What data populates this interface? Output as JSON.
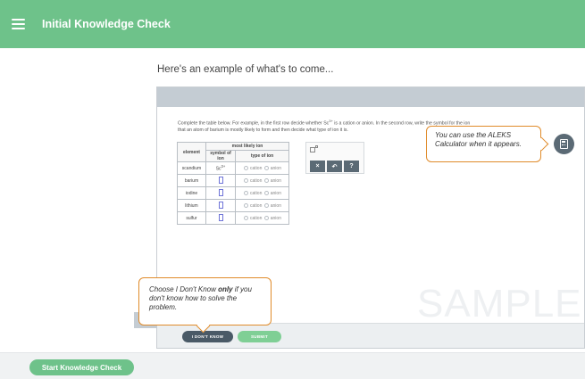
{
  "header": {
    "title": "Initial Knowledge Check"
  },
  "intro": "Here's an example of what's to come...",
  "question": {
    "line1_a": "Complete the table below. For example, in the first row decide whether Sc",
    "line1_sup": "3+",
    "line1_b": " is a cation or anion. In the second row, write the symbol for the ion",
    "line2": "that an atom of barium is mostly likely to form and then decide what type of ion it is."
  },
  "table": {
    "header_element": "element",
    "header_group": "most likely ion",
    "header_symbol": "symbol of ion",
    "header_type": "type of ion",
    "cation_label": "cation",
    "anion_label": "anion",
    "rows": [
      {
        "element": "scandium",
        "symbol": "Sc",
        "sup": "3+"
      },
      {
        "element": "barium"
      },
      {
        "element": "iodine"
      },
      {
        "element": "lithium"
      },
      {
        "element": "sulfur"
      }
    ]
  },
  "tools": {
    "clear": "×",
    "undo": "↶",
    "help": "?"
  },
  "calculator_callout": "You can use the ALEKS Calculator when it appears.",
  "watermark": "SAMPLE",
  "idk_callout": {
    "before": "Choose I Don't Know ",
    "emph": "only",
    "after": " if you don't know how to solve the problem."
  },
  "buttons": {
    "idk": "I DON'T KNOW",
    "submit": "SUBMIT",
    "start": "Start Knowledge Check"
  },
  "colors": {
    "brand": "#6ec28a",
    "callout_border": "#e08b2a",
    "dark": "#4a5a67"
  }
}
